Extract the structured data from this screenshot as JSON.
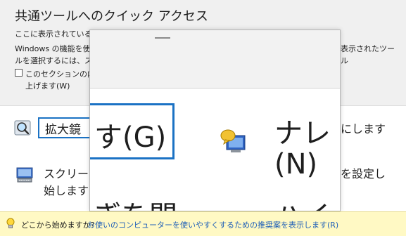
{
  "header": {
    "title": "共通ツールへのクイック アクセス",
    "desc_line1": "ここに表示されているツ",
    "desc_line2_left": "Windows の機能を使",
    "desc_line2_right": "表示されたツー",
    "desc_line3_left": "ルを選択するには、スペ",
    "desc_line3_right": "ル",
    "checkbox_line1": "このセクションの内容",
    "checkbox_line2": "上げます(W)"
  },
  "rows": {
    "magnifier_label": "拡大鏡",
    "magnifier_right": "にします",
    "screen_label_line1": "スクリー",
    "screen_label_line2": "始します",
    "screen_right_line1": "を設定し"
  },
  "magnifier_window": {
    "zoom_text_g": "す(G)",
    "zoom_text_nare": "ナレ",
    "zoom_text_n": "(N)",
    "zoom_frag_bottom_left": "ぎを開",
    "zoom_frag_bottom_right": "ハイ"
  },
  "hint_bar": {
    "question": "どこから始めますか?",
    "link": "お使いのコンピューターを使いやすくするための推奨案を表示します(R)"
  },
  "colors": {
    "header_bg": "#f0f0f0",
    "focus_blue": "#1b72c4",
    "hint_bg": "#fff9c4",
    "link_blue": "#1f5fb8"
  },
  "icons": {
    "magnifier": "magnifier-icon",
    "narrator": "narrator-icon",
    "screen_keyboard": "on-screen-keyboard-icon",
    "hint": "lightbulb-icon"
  }
}
